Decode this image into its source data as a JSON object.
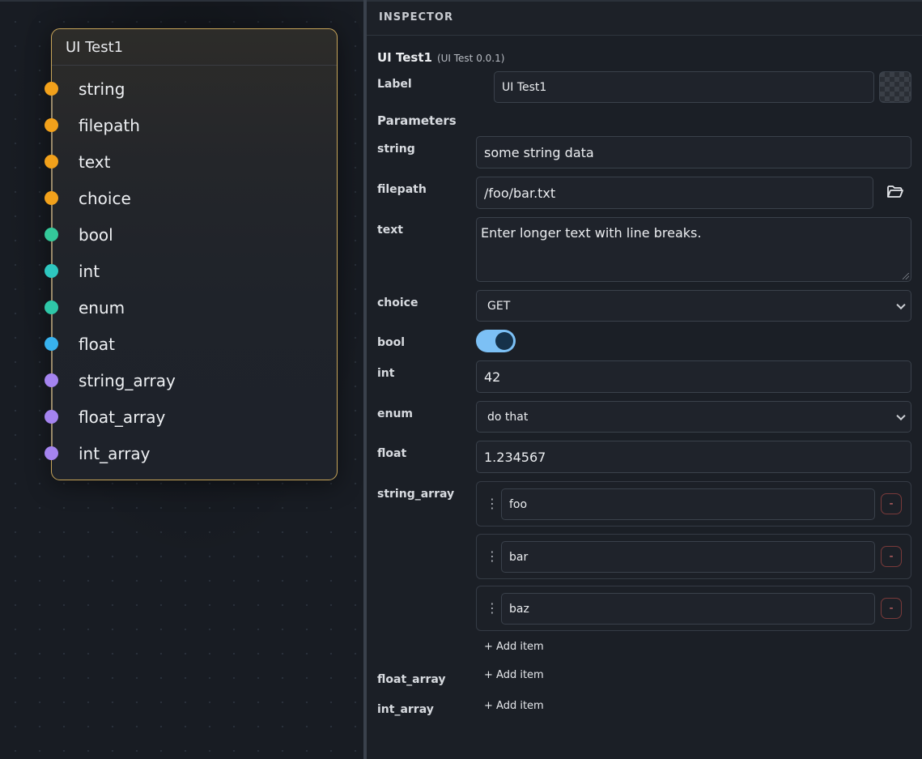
{
  "node": {
    "title": "UI Test1",
    "ports": [
      {
        "name": "string",
        "color": "#f2a11b"
      },
      {
        "name": "filepath",
        "color": "#f2a11b"
      },
      {
        "name": "text",
        "color": "#f2a11b"
      },
      {
        "name": "choice",
        "color": "#f2a11b"
      },
      {
        "name": "bool",
        "color": "#34c99a"
      },
      {
        "name": "int",
        "color": "#2ec7c0"
      },
      {
        "name": "enum",
        "color": "#2ec7a8"
      },
      {
        "name": "float",
        "color": "#38b3ef"
      },
      {
        "name": "string_array",
        "color": "#a584f0"
      },
      {
        "name": "float_array",
        "color": "#a584f0"
      },
      {
        "name": "int_array",
        "color": "#a584f0"
      }
    ]
  },
  "inspector": {
    "header": "INSPECTOR",
    "node_title": "UI Test1",
    "node_version": "(UI Test 0.0.1)",
    "label_caption": "Label",
    "label_value": "UI Test1",
    "parameters_caption": "Parameters",
    "fields": {
      "string": {
        "label": "string",
        "value": "some string data"
      },
      "filepath": {
        "label": "filepath",
        "value": "/foo/bar.txt",
        "icon": "folder-open-icon"
      },
      "text": {
        "label": "text",
        "value": "Enter longer text with line breaks."
      },
      "choice": {
        "label": "choice",
        "value": "GET"
      },
      "bool": {
        "label": "bool",
        "value": true
      },
      "int": {
        "label": "int",
        "value": "42"
      },
      "enum": {
        "label": "enum",
        "value": "do that"
      },
      "float": {
        "label": "float",
        "value": "1.234567"
      },
      "string_array": {
        "label": "string_array",
        "items": [
          "foo",
          "bar",
          "baz"
        ]
      },
      "float_array": {
        "label": "float_array"
      },
      "int_array": {
        "label": "int_array"
      }
    },
    "add_item_label": "+ Add item",
    "remove_label": "-",
    "drag_handle": "⋮"
  },
  "colors": {
    "node_border": "#c9a65a",
    "toggle_on": "#7cc0f5",
    "remove_red": "#e47272"
  }
}
